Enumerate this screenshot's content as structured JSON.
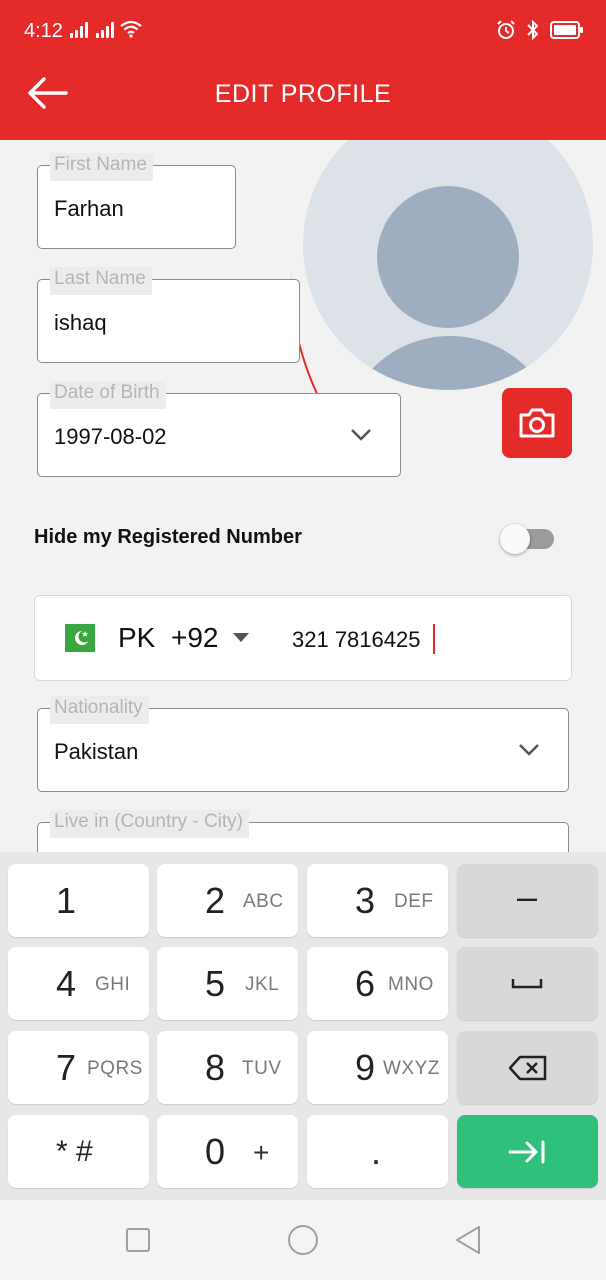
{
  "status_bar": {
    "time": "4:12",
    "network": "signal-icon",
    "wifi": "wifi-icon",
    "alarm": "alarm-icon",
    "bluetooth": "bluetooth-icon",
    "battery": "battery-icon"
  },
  "header": {
    "title": "EDIT PROFILE",
    "back_icon": "arrow-left-icon",
    "color": "#e52a2a"
  },
  "avatar": {
    "icon": "user-placeholder-icon",
    "camera_icon": "camera-icon"
  },
  "form": {
    "first_name": {
      "label": "First Name",
      "value": "Farhan"
    },
    "last_name": {
      "label": "Last Name",
      "value": "ishaq"
    },
    "dob": {
      "label": "Date of Birth",
      "value": "1997-08-02"
    },
    "hide_number": {
      "label": "Hide my Registered Number",
      "enabled": false
    },
    "phone": {
      "flag_icon": "pakistan-flag-icon",
      "country": "PK",
      "dial_code": "+92",
      "number": "321 7816425"
    },
    "nationality": {
      "label": "Nationality",
      "value": "Pakistan"
    },
    "live_in": {
      "label": "Live in (Country - City)",
      "value": ""
    }
  },
  "keyboard": {
    "keys": [
      {
        "num": "1",
        "letters": ""
      },
      {
        "num": "2",
        "letters": "ABC"
      },
      {
        "num": "3",
        "letters": "DEF"
      },
      {
        "num": "–",
        "letters": ""
      },
      {
        "num": "4",
        "letters": "GHI"
      },
      {
        "num": "5",
        "letters": "JKL"
      },
      {
        "num": "6",
        "letters": "MNO"
      },
      {
        "num": "space",
        "letters": ""
      },
      {
        "num": "7",
        "letters": "PQRS"
      },
      {
        "num": "8",
        "letters": "TUV"
      },
      {
        "num": "9",
        "letters": "WXYZ"
      },
      {
        "num": "backspace",
        "letters": ""
      },
      {
        "num": "* #",
        "letters": ""
      },
      {
        "num": "0",
        "letters": "+"
      },
      {
        "num": ".",
        "letters": ""
      },
      {
        "num": "next",
        "letters": ""
      }
    ],
    "accent": "#2fc17c"
  },
  "navbar": {
    "recents": "square-icon",
    "home": "circle-icon",
    "back": "triangle-back-icon"
  }
}
